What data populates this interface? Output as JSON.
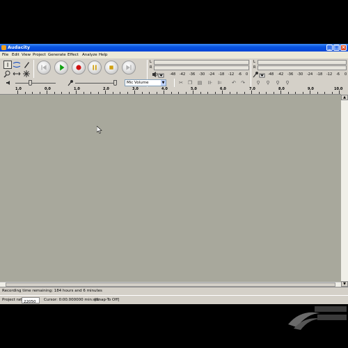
{
  "window": {
    "title": "Audacity",
    "controls": [
      "_",
      "□",
      "×"
    ]
  },
  "menu": [
    "File",
    "Edit",
    "View",
    "Project",
    "Generate",
    "Effect",
    "Analyze",
    "Help"
  ],
  "meters": {
    "play_scale": [
      "-48",
      "-42",
      "-36",
      "-30",
      "-24",
      "-18",
      "-12",
      "-6",
      "0"
    ],
    "record_scale": [
      "-48",
      "-42",
      "-36",
      "-30",
      "-24",
      "-18",
      "-12",
      "-6",
      "0"
    ],
    "channel_left": "L",
    "channel_right": "R"
  },
  "mixer": {
    "input_dropdown": "Mic Volume",
    "dropdown_arrow": "▼"
  },
  "ruler": {
    "labels": [
      "1.0",
      "0.0",
      "1.0",
      "2.0",
      "3.0",
      "4.0",
      "5.0",
      "6.0",
      "7.0",
      "8.0",
      "9.0",
      "10.0"
    ]
  },
  "status": {
    "recording_time": "Recording time remaining: 184 hours and 6 minutes",
    "project_rate_label": "Project rate:",
    "project_rate_value": "22050",
    "cursor_text": "Cursor: 0:00.000000 min:sec",
    "snap_text": "[Snap-To Off]"
  },
  "icons": {
    "tools": [
      "selection-icon",
      "envelope-icon",
      "draw-icon",
      "zoom-icon",
      "timeshift-icon",
      "multi-icon"
    ],
    "transport": [
      "skip-start-icon",
      "play-icon",
      "record-icon",
      "pause-icon",
      "stop-icon",
      "skip-end-icon"
    ]
  },
  "colors": {
    "title_bar": "#0a54e0",
    "track_area": "#a8a89c",
    "record_red": "#d01010",
    "play_green": "#10a010"
  }
}
